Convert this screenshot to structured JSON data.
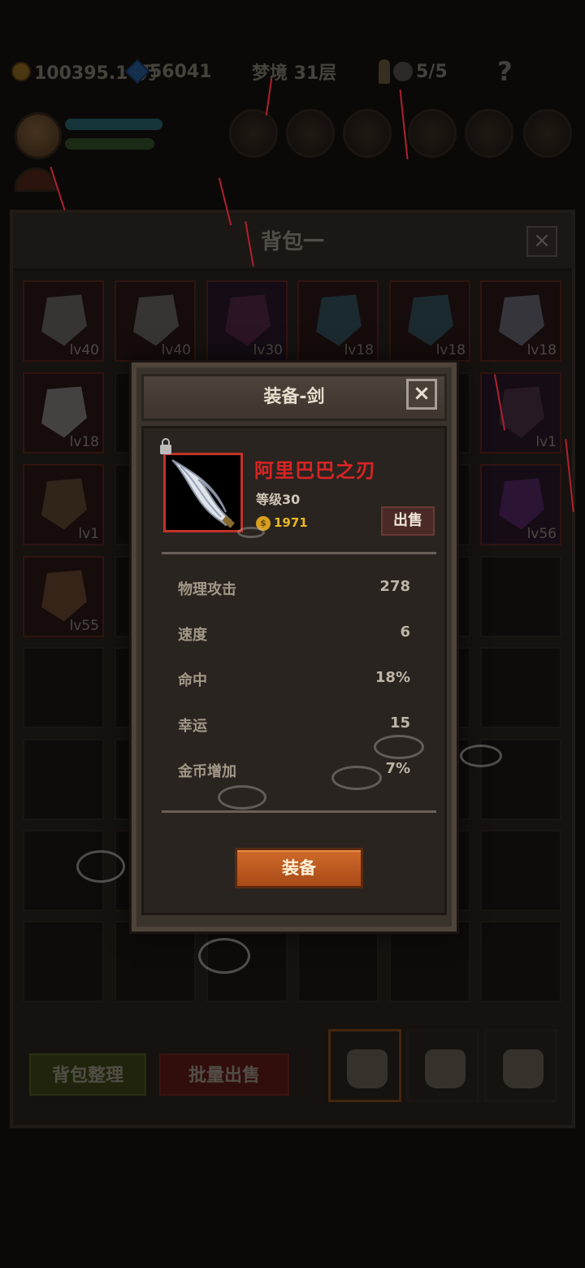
{
  "top_bar": {
    "gold": "100395.10万",
    "gems": "56041",
    "stage": "梦境 31层",
    "keys": "5/5"
  },
  "inventory": {
    "title": "背包一",
    "close_icon": "×",
    "slots": [
      {
        "level": "lv40",
        "icon": "cleaver-icon"
      },
      {
        "level": "lv40",
        "icon": "cleaver-icon"
      },
      {
        "level": "lv30",
        "icon": "armor-icon"
      },
      {
        "level": "lv18",
        "icon": "axe-icon"
      },
      {
        "level": "lv18",
        "icon": "axe-icon"
      },
      {
        "level": "lv18",
        "icon": "scythe-icon"
      },
      {
        "level": "lv18",
        "icon": "dagger-icon"
      },
      {
        "level": "lv1",
        "icon": "helmet-icon"
      },
      {
        "level": "lv1",
        "icon": "shield-icon"
      },
      {
        "level": "lv56",
        "icon": "bow-icon"
      },
      {
        "level": "lv55",
        "icon": "ring-icon"
      }
    ],
    "sort_button": "背包整理",
    "bulk_sell_button": "批量出售"
  },
  "dialog": {
    "title": "装备-剑",
    "close_label": "×",
    "item": {
      "name": "阿里巴巴之刃",
      "level": "等级30",
      "price": "1971",
      "coin_glyph": "$",
      "icon": "sword-icon"
    },
    "sell_button": "出售",
    "stats": [
      {
        "label": "物理攻击",
        "value": "278"
      },
      {
        "label": "速度",
        "value": "6"
      },
      {
        "label": "命中",
        "value": "18%"
      },
      {
        "label": "幸运",
        "value": "15"
      },
      {
        "label": "金币增加",
        "value": "7%"
      }
    ],
    "equip_button": "装备"
  },
  "colors": {
    "item_name": "#d82424",
    "price": "#e8b820",
    "equip_button": "#c0602a"
  }
}
